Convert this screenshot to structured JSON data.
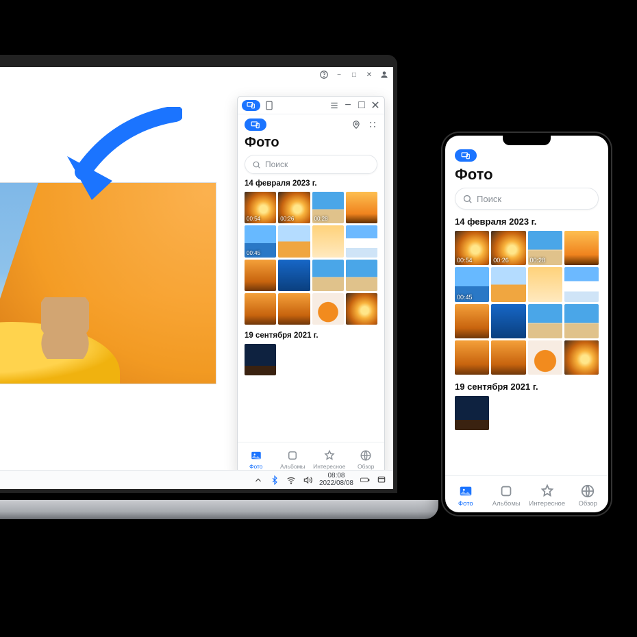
{
  "colors": {
    "accent": "#1b74ff"
  },
  "laptop": {
    "taskbar": {
      "time": "08:08",
      "date": "2022/08/08"
    }
  },
  "mirror": {
    "title": "Фото",
    "search_placeholder": "Поиск",
    "tabs": {
      "photos": "Фото",
      "albums": "Альбомы",
      "highlights": "Интересное",
      "browse": "Обзор"
    },
    "sections": [
      {
        "heading": "14 февраля 2023 г.",
        "items": [
          {
            "cls": "p-sunset",
            "dur": "00:54"
          },
          {
            "cls": "p-sunset",
            "dur": "00:26"
          },
          {
            "cls": "p-beach",
            "dur": "00:28"
          },
          {
            "cls": "p-silh",
            "dur": ""
          },
          {
            "cls": "p-boat",
            "dur": "00:45"
          },
          {
            "cls": "p-ice",
            "dur": ""
          },
          {
            "cls": "p-flip",
            "dur": ""
          },
          {
            "cls": "p-ski",
            "dur": ""
          },
          {
            "cls": "p-rock",
            "dur": ""
          },
          {
            "cls": "p-water",
            "dur": ""
          },
          {
            "cls": "p-beach",
            "dur": ""
          },
          {
            "cls": "p-beach",
            "dur": ""
          },
          {
            "cls": "p-rock",
            "dur": ""
          },
          {
            "cls": "p-rock",
            "dur": ""
          },
          {
            "cls": "p-umb",
            "dur": ""
          },
          {
            "cls": "p-sunset",
            "dur": ""
          }
        ]
      },
      {
        "heading": "19 сентября 2021 г.",
        "items": [
          {
            "cls": "p-camp",
            "dur": ""
          }
        ]
      }
    ]
  },
  "phone": {
    "title": "Фото",
    "search_placeholder": "Поиск",
    "tabs": {
      "photos": "Фото",
      "albums": "Альбомы",
      "highlights": "Интересное",
      "browse": "Обзор"
    },
    "sections": [
      {
        "heading": "14 февраля 2023 г.",
        "items": [
          {
            "cls": "p-sunset",
            "dur": "00:54"
          },
          {
            "cls": "p-sunset",
            "dur": "00:26"
          },
          {
            "cls": "p-beach",
            "dur": "00:28"
          },
          {
            "cls": "p-silh",
            "dur": ""
          },
          {
            "cls": "p-boat",
            "dur": "00:45"
          },
          {
            "cls": "p-ice",
            "dur": ""
          },
          {
            "cls": "p-flip",
            "dur": ""
          },
          {
            "cls": "p-ski",
            "dur": ""
          },
          {
            "cls": "p-rock",
            "dur": ""
          },
          {
            "cls": "p-water",
            "dur": ""
          },
          {
            "cls": "p-beach",
            "dur": ""
          },
          {
            "cls": "p-beach",
            "dur": ""
          },
          {
            "cls": "p-rock",
            "dur": ""
          },
          {
            "cls": "p-rock",
            "dur": ""
          },
          {
            "cls": "p-umb",
            "dur": ""
          },
          {
            "cls": "p-sunset",
            "dur": ""
          }
        ]
      },
      {
        "heading": "19 сентября 2021 г.",
        "items": [
          {
            "cls": "p-camp",
            "dur": ""
          }
        ]
      }
    ]
  }
}
